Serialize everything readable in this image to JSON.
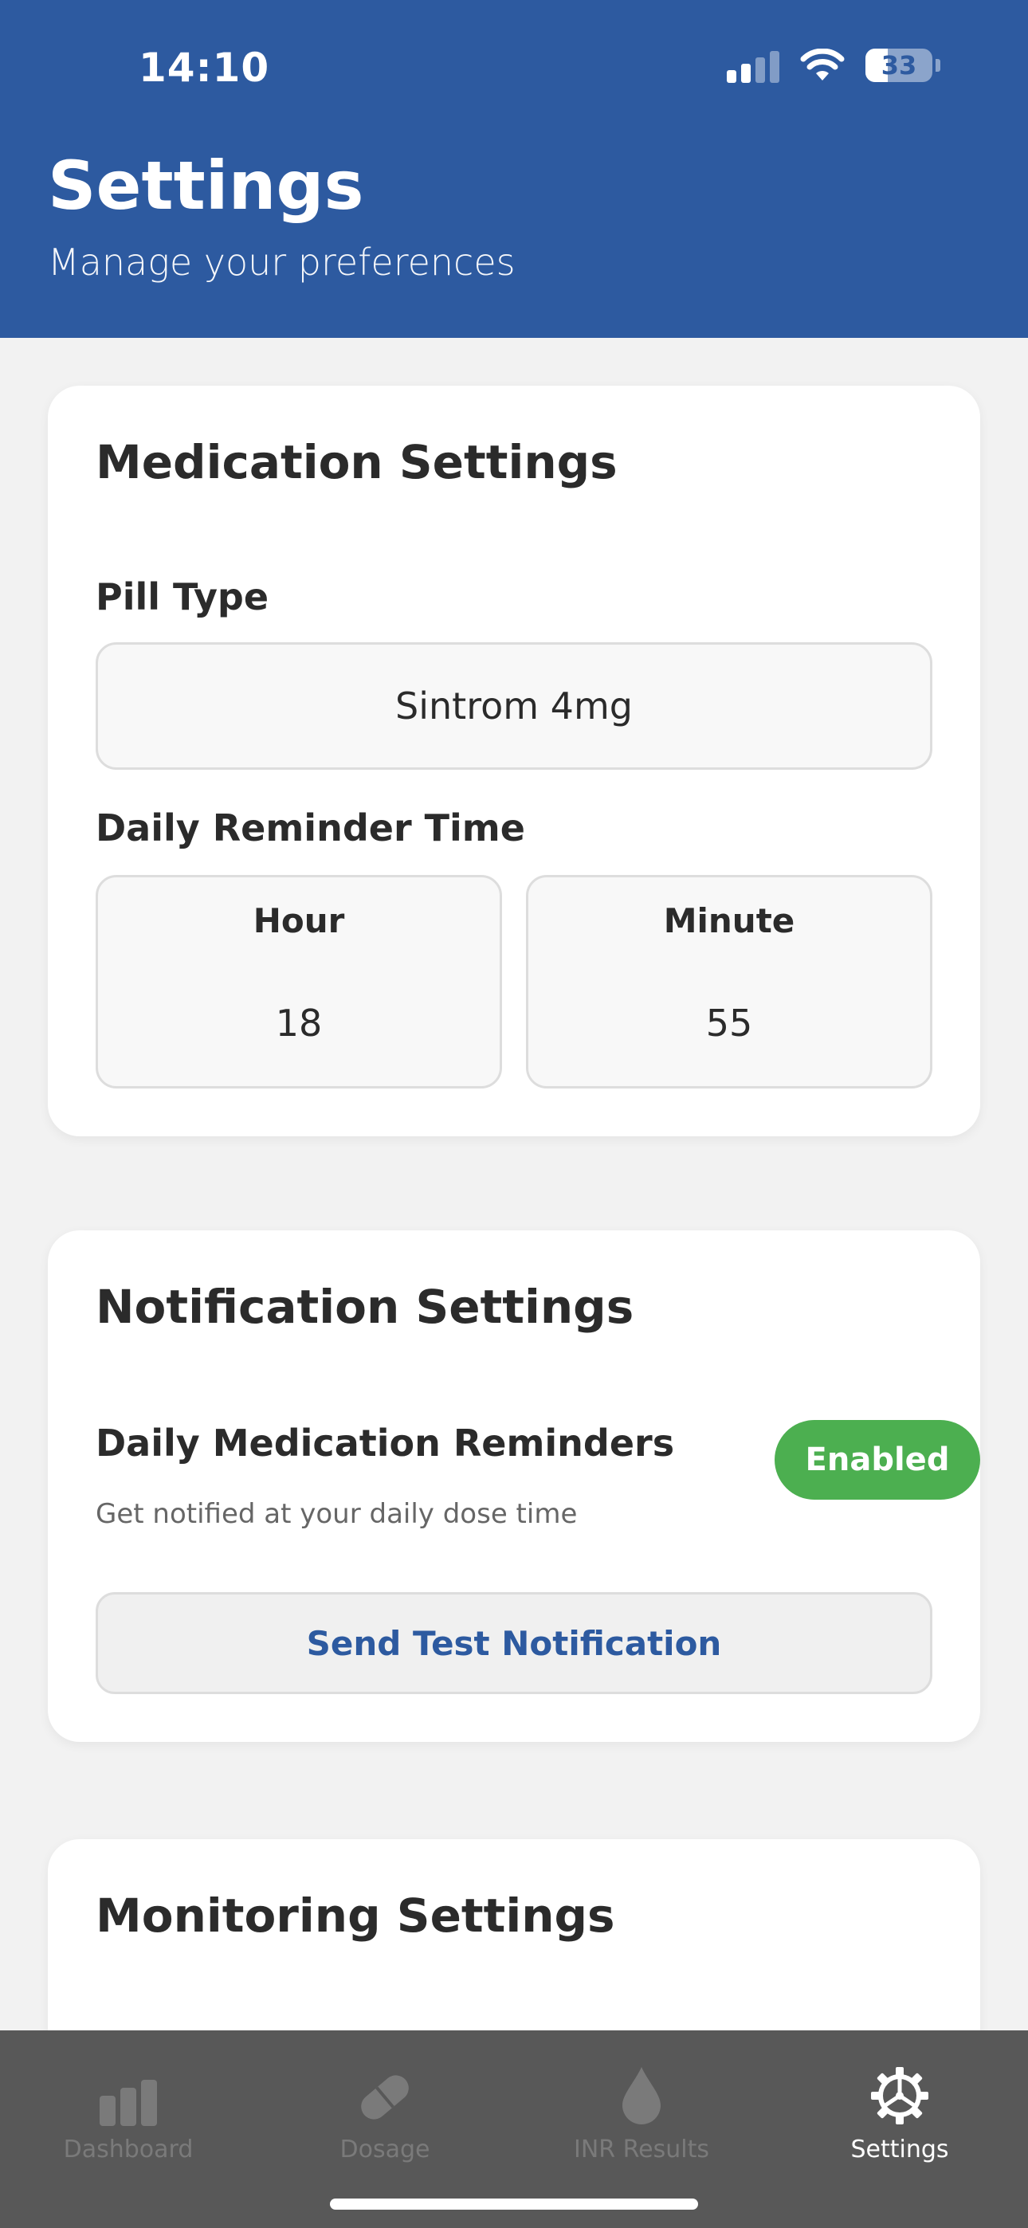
{
  "status_bar": {
    "time": "14:10",
    "battery": "33"
  },
  "header": {
    "title": "Settings",
    "subtitle": "Manage your preferences"
  },
  "medication": {
    "title": "Medication Settings",
    "pill_type_label": "Pill Type",
    "pill_type_value": "Sintrom 4mg",
    "reminder_label": "Daily Reminder Time",
    "hour_label": "Hour",
    "hour_value": "18",
    "minute_label": "Minute",
    "minute_value": "55"
  },
  "notification": {
    "title": "Notification Settings",
    "reminders_label": "Daily Medication Reminders",
    "reminders_help": "Get notified at your daily dose time",
    "toggle_label": "Enabled",
    "test_button": "Send Test Notification"
  },
  "monitoring": {
    "title": "Monitoring Settings"
  },
  "tabs": [
    {
      "label": "Dashboard",
      "icon": "bar-chart-icon"
    },
    {
      "label": "Dosage",
      "icon": "pill-icon"
    },
    {
      "label": "INR Results",
      "icon": "drop-icon"
    },
    {
      "label": "Settings",
      "icon": "gear-icon"
    }
  ],
  "colors": {
    "primary": "#2d5aa0",
    "success": "#4caf50",
    "tabbar": "#585858"
  }
}
